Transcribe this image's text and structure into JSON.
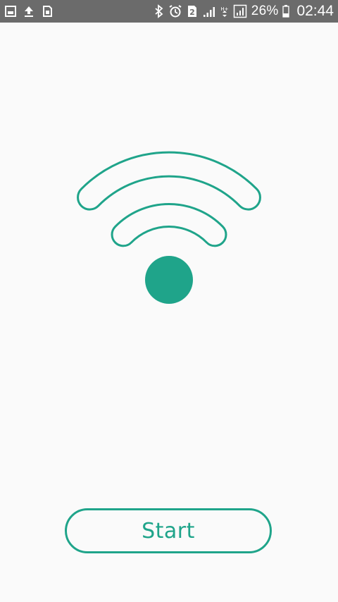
{
  "status_bar": {
    "icons_left": [
      "gallery-icon",
      "upload-icon",
      "sim-icon"
    ],
    "icons_right": [
      "bluetooth-icon",
      "alarm-icon",
      "sim2-icon",
      "signal-icon",
      "data-icon",
      "signal-2-icon"
    ],
    "battery_percent": "26%",
    "time": "02:44"
  },
  "wifi": {
    "icon": "wifi-icon",
    "color": "#1fa48a"
  },
  "actions": {
    "start_label": "Start"
  }
}
